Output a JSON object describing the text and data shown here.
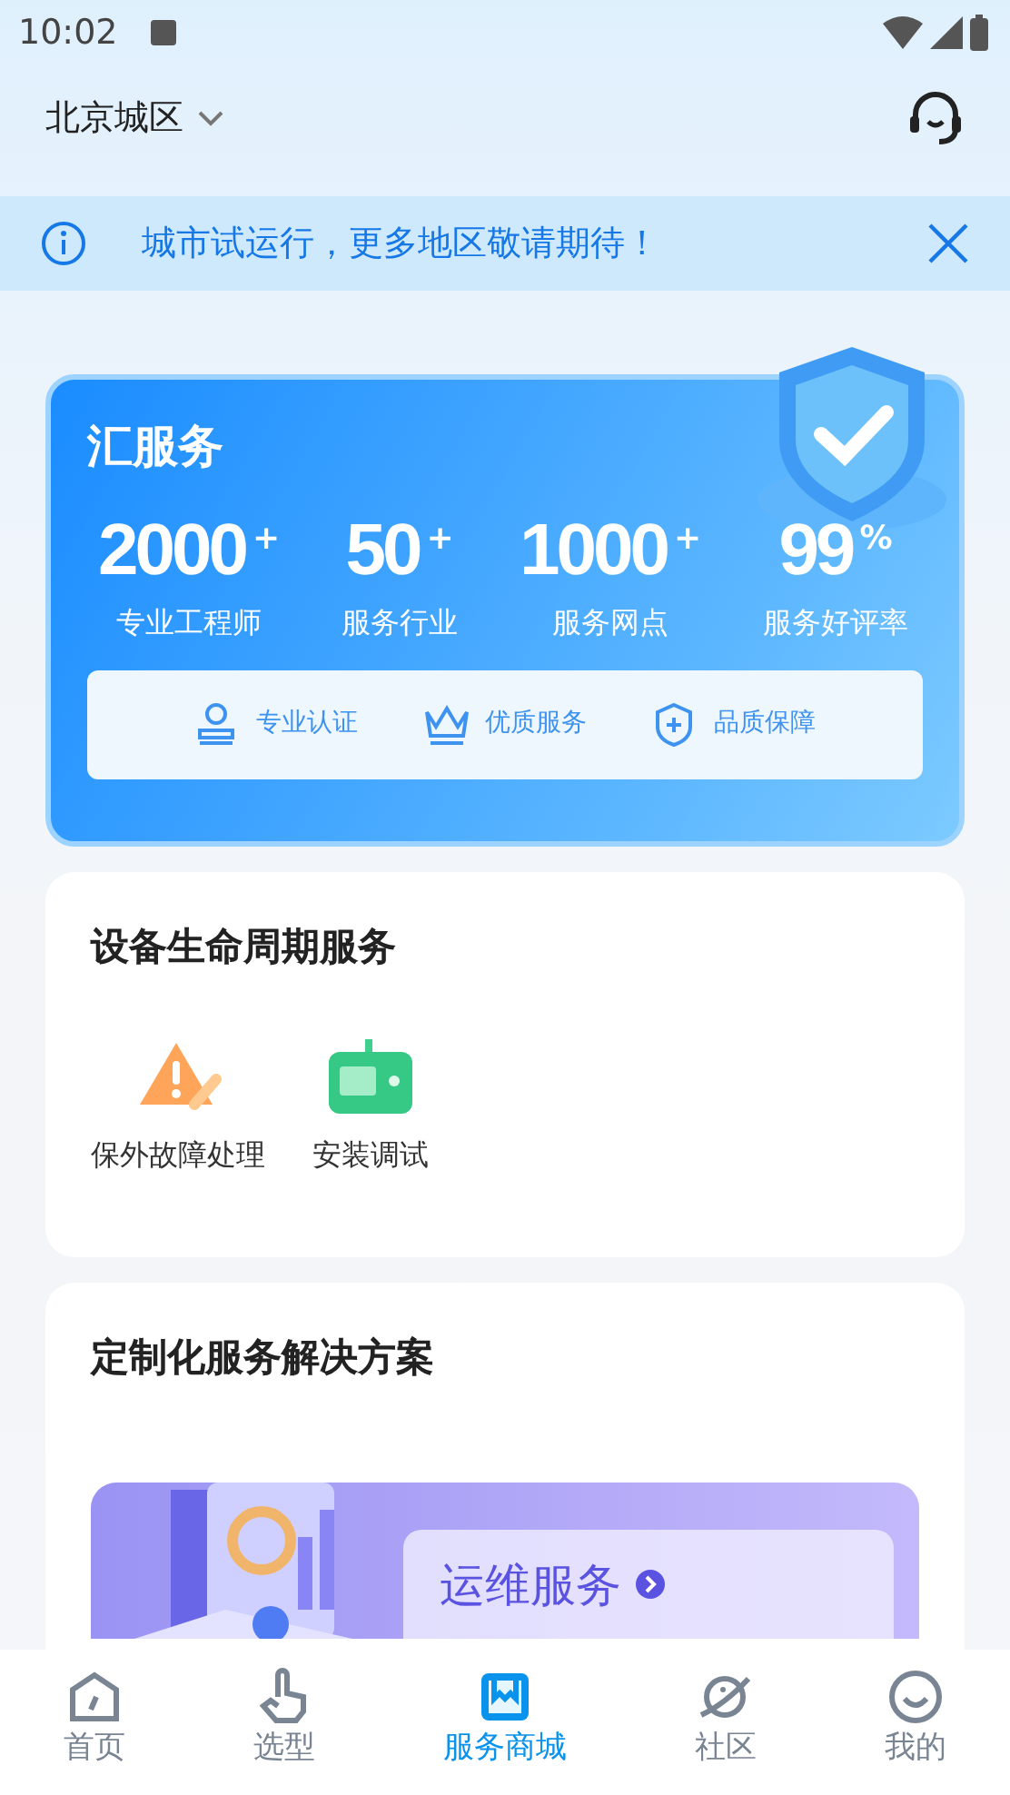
{
  "status_bar": {
    "time": "10:02"
  },
  "header": {
    "city": "北京城区"
  },
  "notice": {
    "text": "城市试运行，更多地区敬请期待！"
  },
  "summary": {
    "title": "汇服务",
    "stats": [
      {
        "value": "2000",
        "suffix": "+",
        "label": "专业工程师"
      },
      {
        "value": "50",
        "suffix": "+",
        "label": "服务行业"
      },
      {
        "value": "1000",
        "suffix": "+",
        "label": "服务网点"
      },
      {
        "value": "99",
        "suffix": "%",
        "label": "服务好评率"
      }
    ],
    "badges": [
      {
        "kind": "stamp",
        "label": "专业认证"
      },
      {
        "kind": "crown",
        "label": "优质服务"
      },
      {
        "kind": "shield",
        "label": "品质保障"
      }
    ]
  },
  "lifecycle": {
    "title": "设备生命周期服务",
    "items": [
      {
        "kind": "repair",
        "label": "保外故障处理"
      },
      {
        "kind": "install",
        "label": "安装调试"
      }
    ]
  },
  "solutions": {
    "title": "定制化服务解决方案",
    "banner": {
      "title": "运维服务"
    }
  },
  "tabs": [
    {
      "kind": "home",
      "label": "首页",
      "selected": false
    },
    {
      "kind": "pick",
      "label": "选型",
      "selected": false
    },
    {
      "kind": "mall",
      "label": "服务商城",
      "selected": true
    },
    {
      "kind": "community",
      "label": "社区",
      "selected": false
    },
    {
      "kind": "me",
      "label": "我的",
      "selected": false
    }
  ]
}
